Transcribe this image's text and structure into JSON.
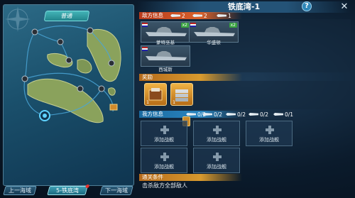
{
  "map": {
    "difficulty_tab": "普通"
  },
  "nav": {
    "prev": "上一海域",
    "current": "5-铁底湾",
    "next": "下一海域"
  },
  "title": "铁底湾-1",
  "help_icon": "?",
  "close_icon": "✕",
  "enemy": {
    "header": "敌方信息",
    "counts": [
      "2",
      "2",
      "1"
    ],
    "ships": [
      {
        "name": "蒙特巫基",
        "level": "x2"
      },
      {
        "name": "华盛顿",
        "level": "x2"
      },
      {
        "name": "西城斯",
        "level": ""
      }
    ]
  },
  "reward": {
    "header": "奖励",
    "items": [
      {
        "icon": "supply-crate-icon",
        "count": "1"
      },
      {
        "icon": "steel-plates-icon",
        "count": "1"
      }
    ]
  },
  "mine": {
    "header": "我方信息",
    "counts": [
      "0/2",
      "0/2",
      "0/2",
      "0/2",
      "0/1"
    ],
    "slot_label": "添加战舰",
    "slots": [
      "添加战舰",
      "添加战舰",
      "添加战舰",
      "添加战舰",
      "添加战舰"
    ]
  },
  "clear": {
    "header": "通关条件",
    "text": "击杀敌方全部敌人"
  }
}
